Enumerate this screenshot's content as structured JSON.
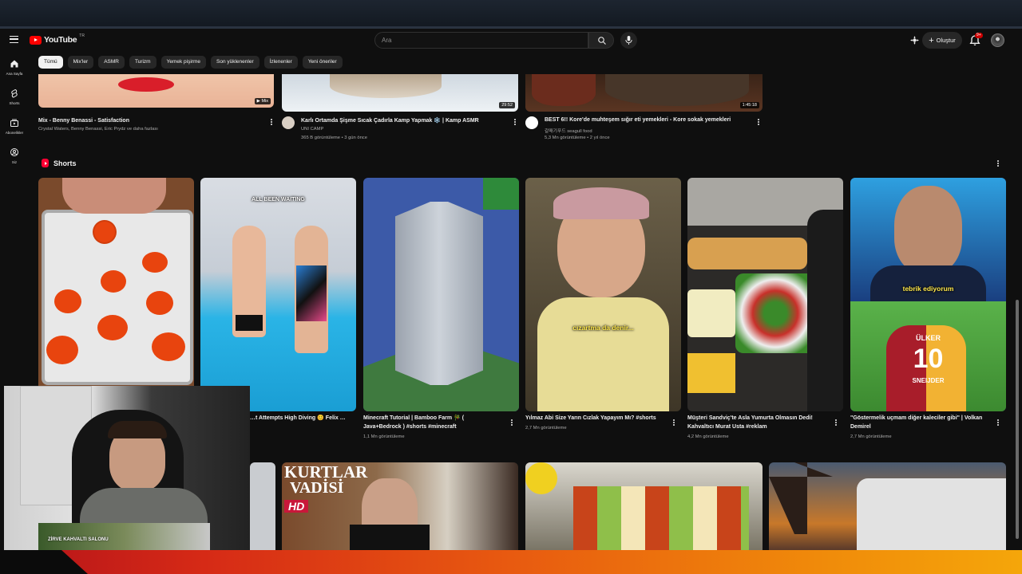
{
  "masthead": {
    "logo_text": "YouTube",
    "logo_country": "TR",
    "search_placeholder": "Ara",
    "create_label": "Oluştur",
    "notification_count": "9+"
  },
  "sidebar": {
    "items": [
      {
        "label": "Ana Sayfa",
        "icon": "home-icon"
      },
      {
        "label": "Shorts",
        "icon": "shorts-icon"
      },
      {
        "label": "Abonelikler",
        "icon": "subscriptions-icon"
      },
      {
        "label": "Siz",
        "icon": "you-icon"
      }
    ]
  },
  "chips": [
    "Tümü",
    "Mix'ler",
    "ASMR",
    "Turizm",
    "Yemek pişirme",
    "Son yüklenenler",
    "İzlenenler",
    "Yeni öneriler"
  ],
  "top_videos": [
    {
      "title": "Mix - Benny Benassi - Satisfaction",
      "channel": "Crystal Waters, Benny Benassi, Eric Prydz ve daha fazlası",
      "meta": "",
      "badge": "Mix"
    },
    {
      "title": "Karlı Ortamda Şişme Sıcak Çadırla Kamp Yapmak ❄️ | Kamp ASMR",
      "channel": "UNI CAMP",
      "meta": "365 B görüntüleme • 3 gün önce",
      "badge": "29:52"
    },
    {
      "title": "BEST 6!! Kore'de muhteşem sığır eti yemekleri - Kore sokak yemekleri",
      "channel": "갈매기푸드 seagull food",
      "meta": "5,3 Mn görüntüleme • 2 yıl önce",
      "badge": "1:45:18"
    }
  ],
  "shorts": {
    "heading": "Shorts",
    "items": [
      {
        "title": "",
        "views": "",
        "caption": ""
      },
      {
        "title": "…t Attempts High Diving 😊 Felix …",
        "views": "",
        "caption": "ALL BEEN WAITING"
      },
      {
        "title": "Minecraft Tutorial | Bamboo Farm 🎋 ( Java+Bedrock ) #shorts #minecraft",
        "views": "1,1 Mn görüntüleme",
        "caption": ""
      },
      {
        "title": "Yılmaz Abi Size Yarın Cızlak Yapayım Mı? #shorts",
        "views": "2,7 Mn görüntüleme",
        "caption": "cızartma da denir..."
      },
      {
        "title": "Müşteri Sandviç'te Asla Yumurta Olmasın Dedi! Kahvaltıcı Murat Usta #reklam",
        "views": "4,2 Mn görüntüleme",
        "caption": ""
      },
      {
        "title": "\"Göstermelik uçmam diğer kaleciler gibi\" | Volkan Demirel",
        "views": "2,7 Mn görüntüleme",
        "caption": "tebrik ediyorum"
      }
    ]
  },
  "bottom_row": {
    "kurtlar_title_1": "KURTLAR",
    "kurtlar_title_2": "VADİSİ",
    "kurtlar_hd": "HD",
    "webcam_sign": "ZİRVE KAHVALTI SALONU"
  },
  "extra_text": {
    "jersey_name": "ÜLKER",
    "jersey_number": "10",
    "jersey_player": "SNEIJDER"
  },
  "colors": {
    "accent_red": "#ff0000",
    "background": "#0f0f0f",
    "caption_yellow": "#ffe94d"
  }
}
